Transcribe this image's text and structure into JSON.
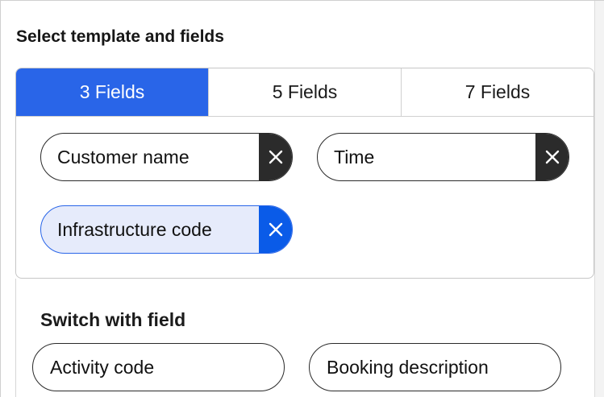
{
  "panel": {
    "title": "Select template and fields"
  },
  "tabs": [
    {
      "label": "3 Fields",
      "active": true
    },
    {
      "label": "5 Fields",
      "active": false
    },
    {
      "label": "7 Fields",
      "active": false
    }
  ],
  "selected_fields": [
    {
      "label": "Customer name",
      "remove_icon": "close-icon",
      "highlighted": false
    },
    {
      "label": "Time",
      "remove_icon": "close-icon",
      "highlighted": false
    },
    {
      "label": "Infrastructure code",
      "remove_icon": "close-icon",
      "highlighted": true
    }
  ],
  "switch_section": {
    "title": "Switch with field",
    "options": [
      {
        "label": "Activity code"
      },
      {
        "label": "Booking description"
      }
    ]
  },
  "colors": {
    "accent": "#2965e8",
    "chip_remove_dark": "#2b2b2b",
    "chip_remove_accent": "#0a5be8",
    "chip_selected_bg": "#e6ebfb"
  }
}
